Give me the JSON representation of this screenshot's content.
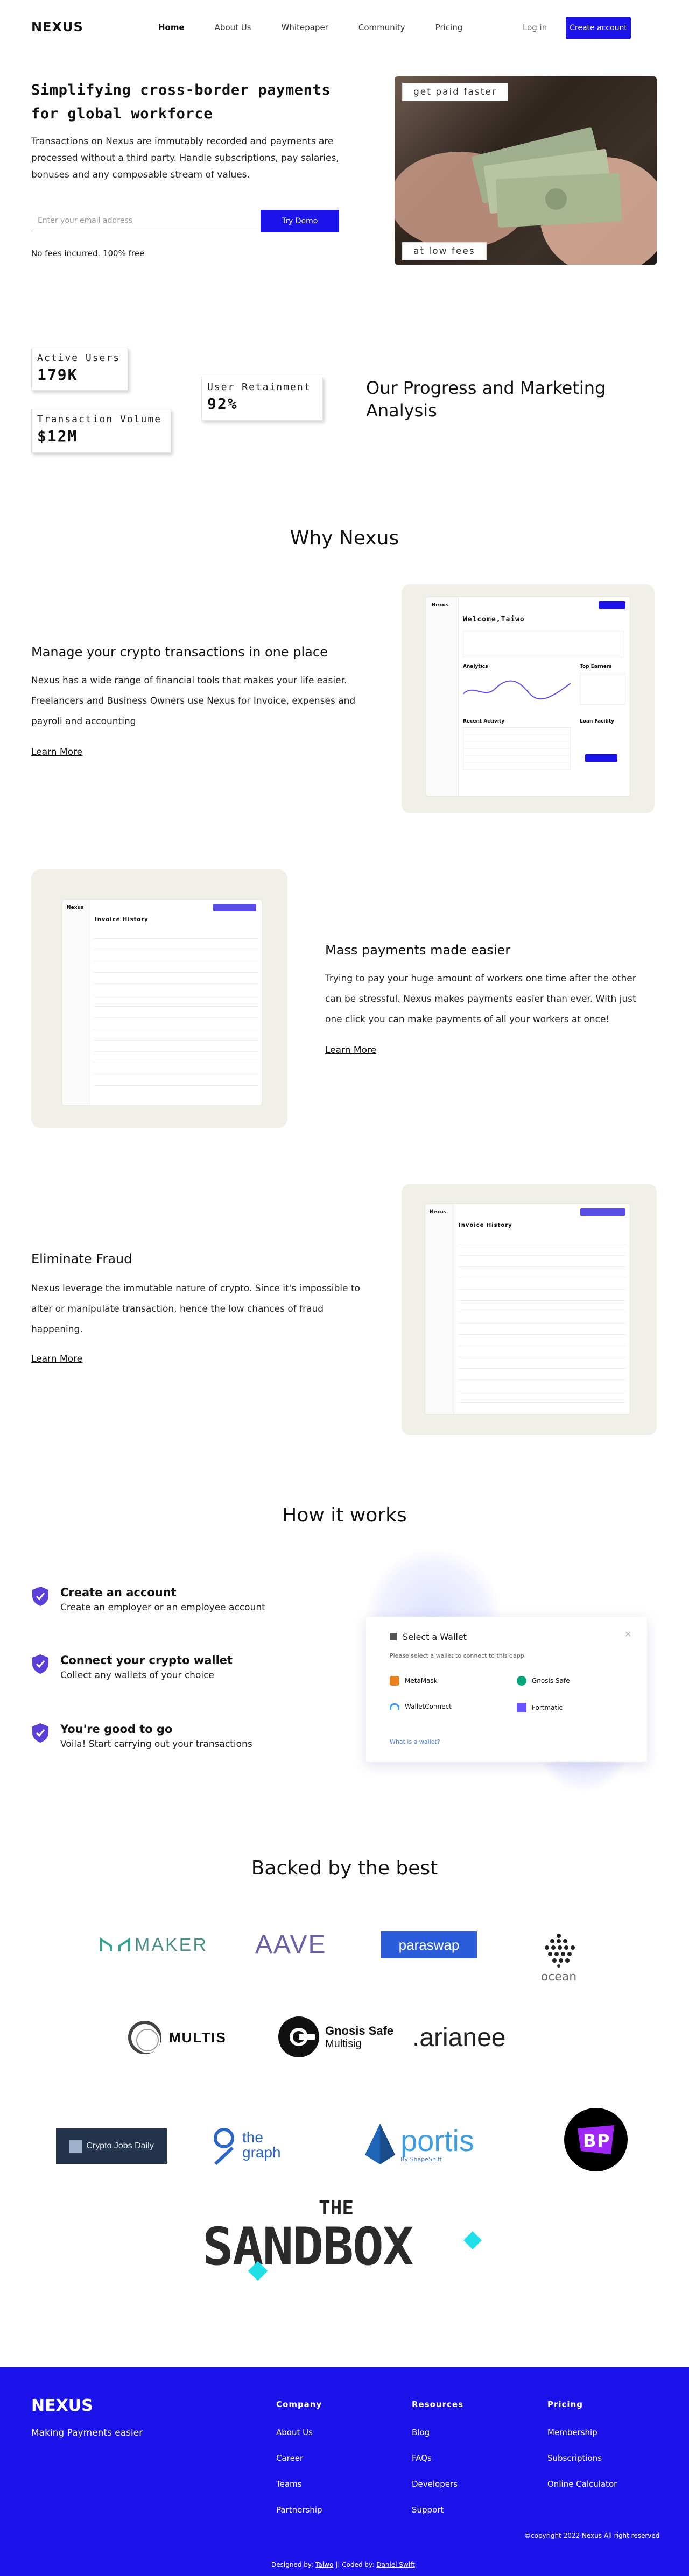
{
  "nav": {
    "logo": "NEXUS",
    "links": [
      "Home",
      "About Us",
      "Whitepaper",
      "Community",
      "Pricing"
    ],
    "login": "Log in",
    "create": "Create account"
  },
  "hero": {
    "title": "Simplifying cross-border payments for global workforce",
    "body": "Transactions on Nexus are immutably recorded and payments are processed without a third party. Handle subscriptions, pay salaries, bonuses and any composable stream of values.",
    "email_placeholder": "Enter your email address",
    "cta": "Try Demo",
    "note": "No fees incurred. 100% free",
    "tag_top": "get paid faster",
    "tag_bottom": "at low fees"
  },
  "stats": {
    "active_users_label": "Active Users",
    "active_users": "179K",
    "retention_label": "User Retainment",
    "retention": "92%",
    "volume_label": "Transaction Volume",
    "volume": "$12M",
    "heading": "Our Progress and Marketing Analysis"
  },
  "why": {
    "title": "Why Nexus",
    "features": [
      {
        "title": "Manage your crypto transactions in one place",
        "body": "Nexus has a wide range of financial tools that makes your life easier. Freelancers and Business Owners use Nexus for Invoice, expenses and payroll and accounting",
        "link": "Learn More"
      },
      {
        "title": "Mass payments made easier",
        "body": "Trying to pay your huge amount of workers one time after the other can be stressful. Nexus makes payments easier than ever. With just one click you can make payments of all your workers at once!",
        "link": "Learn More"
      },
      {
        "title": "Eliminate Fraud",
        "body": "Nexus leverage the immutable nature of crypto. Since it's impossible to alter or manipulate transaction, hence the low chances of fraud happening.",
        "link": "Learn More"
      }
    ],
    "dash": {
      "logo": "Nexus",
      "welcome": "Welcome,Taiwo",
      "analytics": "Analytics",
      "top": "Top Earners",
      "recent": "Recent Activity",
      "fund": "Loan Facility",
      "invoice": "Invoice History",
      "create": "New Pay Invoice"
    }
  },
  "how": {
    "title": "How it works",
    "steps": [
      {
        "title": "Create an account",
        "sub": "Create an employer or an employee account"
      },
      {
        "title": "Connect your crypto wallet",
        "sub": "Collect any wallets of your choice"
      },
      {
        "title": "You're good to go",
        "sub": "Voila! Start carrying out your transactions"
      }
    ],
    "wallet": {
      "title": "Select a Wallet",
      "sub": "Please select a wallet to connect to this dapp:",
      "options": [
        "MetaMask",
        "Gnosis Safe",
        "WalletConnect",
        "Fortmatic"
      ],
      "help": "What is a wallet?"
    }
  },
  "backers": {
    "title": "Backed by the best",
    "logos": [
      "MAKER",
      "AAVE",
      "paraswap",
      "ocean",
      "MULTIS",
      "Gnosis Safe",
      "Multisig",
      ".arianee",
      "Crypto Jobs Daily",
      "the graph",
      "portis",
      "By ShapeShift",
      "THE",
      "SANDBOX"
    ]
  },
  "footer": {
    "logo": "NEXUS",
    "tagline": "Making Payments easier",
    "company": {
      "title": "Company",
      "items": [
        "About Us",
        "Career",
        "Teams",
        "Partnership"
      ]
    },
    "resources": {
      "title": "Resources",
      "items": [
        "Blog",
        "FAQs",
        "Developers",
        "Support"
      ]
    },
    "pricing": {
      "title": "Pricing",
      "items": [
        "Membership",
        "Subscriptions",
        "Online Calculator"
      ]
    },
    "copyright": "©copyright 2022 Nexus All right reserved",
    "credit_prefix": "Designed by:",
    "designer": "Taiwo",
    "credit_mid": "|| Coded by:",
    "coder": "Daniel Swift"
  },
  "colors": {
    "accent": "#1a12e8",
    "feature_bg": "#f1f0e8",
    "step_icon": "#5b3fd6"
  }
}
